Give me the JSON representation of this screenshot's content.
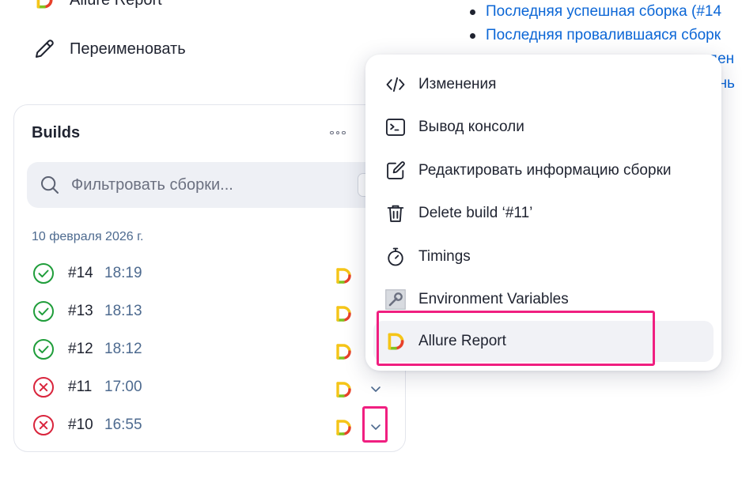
{
  "side": {
    "allure_label": "Allure Report",
    "rename_label": "Переименовать"
  },
  "top_links": [
    "Последняя успешная сборка (#14",
    "Последняя провалившаяся сборк"
  ],
  "peek": {
    "line1": "ден",
    "line2": "ень"
  },
  "builds": {
    "title": "Builds",
    "filter_placeholder": "Фильтровать сборки...",
    "date": "10 февраля 2026 г.",
    "rows": [
      {
        "num": "#14",
        "time": "18:19",
        "status": "success"
      },
      {
        "num": "#13",
        "time": "18:13",
        "status": "success"
      },
      {
        "num": "#12",
        "time": "18:12",
        "status": "success"
      },
      {
        "num": "#11",
        "time": "17:00",
        "status": "failed"
      },
      {
        "num": "#10",
        "time": "16:55",
        "status": "failed"
      }
    ]
  },
  "menu": {
    "items": [
      {
        "label": "Изменения",
        "icon": "code-icon"
      },
      {
        "label": "Вывод консоли",
        "icon": "terminal-icon"
      },
      {
        "label": "Редактировать информацию сборки",
        "icon": "edit-icon"
      },
      {
        "label": "Delete build ‘#11’",
        "icon": "trash-icon"
      },
      {
        "label": "Timings",
        "icon": "stopwatch-icon"
      },
      {
        "label": "Environment Variables",
        "icon": "environment-icon"
      },
      {
        "label": "Allure Report",
        "icon": "allure-icon"
      }
    ]
  },
  "colors": {
    "success": "#1f9d3a",
    "failed": "#d9243c",
    "link": "#0b66d6",
    "highlight": "#f01f80",
    "allure_yellow": "#f5c518",
    "allure_green": "#7fc41f",
    "allure_red": "#e8402a"
  }
}
